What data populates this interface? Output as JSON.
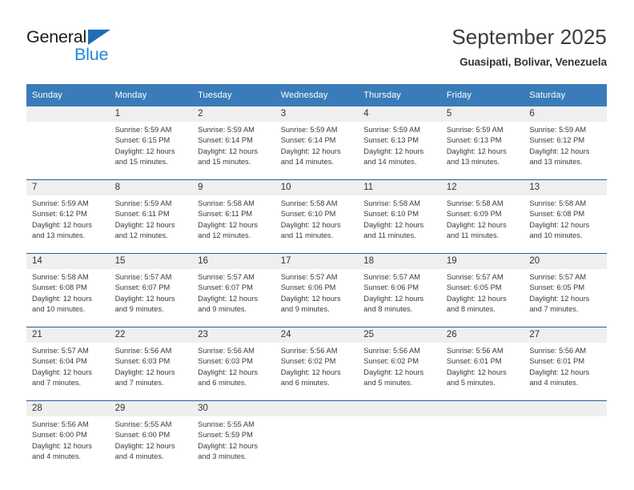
{
  "brand": {
    "name_part1": "General",
    "name_part2": "Blue",
    "accent_color": "#2288d6",
    "triangle_color": "#1f6db5"
  },
  "header": {
    "title": "September 2025",
    "subtitle": "Guasipati, Bolivar, Venezuela"
  },
  "calendar": {
    "header_bg": "#3a7cb9",
    "header_text_color": "#ffffff",
    "daynum_bg": "#efefef",
    "week_separator_color": "#1d5fa0",
    "weekday_headers": [
      "Sunday",
      "Monday",
      "Tuesday",
      "Wednesday",
      "Thursday",
      "Friday",
      "Saturday"
    ],
    "weeks": [
      [
        {
          "day": "",
          "sunrise": "",
          "sunset": "",
          "daylight_line1": "",
          "daylight_line2": ""
        },
        {
          "day": "1",
          "sunrise": "Sunrise: 5:59 AM",
          "sunset": "Sunset: 6:15 PM",
          "daylight_line1": "Daylight: 12 hours",
          "daylight_line2": "and 15 minutes."
        },
        {
          "day": "2",
          "sunrise": "Sunrise: 5:59 AM",
          "sunset": "Sunset: 6:14 PM",
          "daylight_line1": "Daylight: 12 hours",
          "daylight_line2": "and 15 minutes."
        },
        {
          "day": "3",
          "sunrise": "Sunrise: 5:59 AM",
          "sunset": "Sunset: 6:14 PM",
          "daylight_line1": "Daylight: 12 hours",
          "daylight_line2": "and 14 minutes."
        },
        {
          "day": "4",
          "sunrise": "Sunrise: 5:59 AM",
          "sunset": "Sunset: 6:13 PM",
          "daylight_line1": "Daylight: 12 hours",
          "daylight_line2": "and 14 minutes."
        },
        {
          "day": "5",
          "sunrise": "Sunrise: 5:59 AM",
          "sunset": "Sunset: 6:13 PM",
          "daylight_line1": "Daylight: 12 hours",
          "daylight_line2": "and 13 minutes."
        },
        {
          "day": "6",
          "sunrise": "Sunrise: 5:59 AM",
          "sunset": "Sunset: 6:12 PM",
          "daylight_line1": "Daylight: 12 hours",
          "daylight_line2": "and 13 minutes."
        }
      ],
      [
        {
          "day": "7",
          "sunrise": "Sunrise: 5:59 AM",
          "sunset": "Sunset: 6:12 PM",
          "daylight_line1": "Daylight: 12 hours",
          "daylight_line2": "and 13 minutes."
        },
        {
          "day": "8",
          "sunrise": "Sunrise: 5:59 AM",
          "sunset": "Sunset: 6:11 PM",
          "daylight_line1": "Daylight: 12 hours",
          "daylight_line2": "and 12 minutes."
        },
        {
          "day": "9",
          "sunrise": "Sunrise: 5:58 AM",
          "sunset": "Sunset: 6:11 PM",
          "daylight_line1": "Daylight: 12 hours",
          "daylight_line2": "and 12 minutes."
        },
        {
          "day": "10",
          "sunrise": "Sunrise: 5:58 AM",
          "sunset": "Sunset: 6:10 PM",
          "daylight_line1": "Daylight: 12 hours",
          "daylight_line2": "and 11 minutes."
        },
        {
          "day": "11",
          "sunrise": "Sunrise: 5:58 AM",
          "sunset": "Sunset: 6:10 PM",
          "daylight_line1": "Daylight: 12 hours",
          "daylight_line2": "and 11 minutes."
        },
        {
          "day": "12",
          "sunrise": "Sunrise: 5:58 AM",
          "sunset": "Sunset: 6:09 PM",
          "daylight_line1": "Daylight: 12 hours",
          "daylight_line2": "and 11 minutes."
        },
        {
          "day": "13",
          "sunrise": "Sunrise: 5:58 AM",
          "sunset": "Sunset: 6:08 PM",
          "daylight_line1": "Daylight: 12 hours",
          "daylight_line2": "and 10 minutes."
        }
      ],
      [
        {
          "day": "14",
          "sunrise": "Sunrise: 5:58 AM",
          "sunset": "Sunset: 6:08 PM",
          "daylight_line1": "Daylight: 12 hours",
          "daylight_line2": "and 10 minutes."
        },
        {
          "day": "15",
          "sunrise": "Sunrise: 5:57 AM",
          "sunset": "Sunset: 6:07 PM",
          "daylight_line1": "Daylight: 12 hours",
          "daylight_line2": "and 9 minutes."
        },
        {
          "day": "16",
          "sunrise": "Sunrise: 5:57 AM",
          "sunset": "Sunset: 6:07 PM",
          "daylight_line1": "Daylight: 12 hours",
          "daylight_line2": "and 9 minutes."
        },
        {
          "day": "17",
          "sunrise": "Sunrise: 5:57 AM",
          "sunset": "Sunset: 6:06 PM",
          "daylight_line1": "Daylight: 12 hours",
          "daylight_line2": "and 9 minutes."
        },
        {
          "day": "18",
          "sunrise": "Sunrise: 5:57 AM",
          "sunset": "Sunset: 6:06 PM",
          "daylight_line1": "Daylight: 12 hours",
          "daylight_line2": "and 8 minutes."
        },
        {
          "day": "19",
          "sunrise": "Sunrise: 5:57 AM",
          "sunset": "Sunset: 6:05 PM",
          "daylight_line1": "Daylight: 12 hours",
          "daylight_line2": "and 8 minutes."
        },
        {
          "day": "20",
          "sunrise": "Sunrise: 5:57 AM",
          "sunset": "Sunset: 6:05 PM",
          "daylight_line1": "Daylight: 12 hours",
          "daylight_line2": "and 7 minutes."
        }
      ],
      [
        {
          "day": "21",
          "sunrise": "Sunrise: 5:57 AM",
          "sunset": "Sunset: 6:04 PM",
          "daylight_line1": "Daylight: 12 hours",
          "daylight_line2": "and 7 minutes."
        },
        {
          "day": "22",
          "sunrise": "Sunrise: 5:56 AM",
          "sunset": "Sunset: 6:03 PM",
          "daylight_line1": "Daylight: 12 hours",
          "daylight_line2": "and 7 minutes."
        },
        {
          "day": "23",
          "sunrise": "Sunrise: 5:56 AM",
          "sunset": "Sunset: 6:03 PM",
          "daylight_line1": "Daylight: 12 hours",
          "daylight_line2": "and 6 minutes."
        },
        {
          "day": "24",
          "sunrise": "Sunrise: 5:56 AM",
          "sunset": "Sunset: 6:02 PM",
          "daylight_line1": "Daylight: 12 hours",
          "daylight_line2": "and 6 minutes."
        },
        {
          "day": "25",
          "sunrise": "Sunrise: 5:56 AM",
          "sunset": "Sunset: 6:02 PM",
          "daylight_line1": "Daylight: 12 hours",
          "daylight_line2": "and 5 minutes."
        },
        {
          "day": "26",
          "sunrise": "Sunrise: 5:56 AM",
          "sunset": "Sunset: 6:01 PM",
          "daylight_line1": "Daylight: 12 hours",
          "daylight_line2": "and 5 minutes."
        },
        {
          "day": "27",
          "sunrise": "Sunrise: 5:56 AM",
          "sunset": "Sunset: 6:01 PM",
          "daylight_line1": "Daylight: 12 hours",
          "daylight_line2": "and 4 minutes."
        }
      ],
      [
        {
          "day": "28",
          "sunrise": "Sunrise: 5:56 AM",
          "sunset": "Sunset: 6:00 PM",
          "daylight_line1": "Daylight: 12 hours",
          "daylight_line2": "and 4 minutes."
        },
        {
          "day": "29",
          "sunrise": "Sunrise: 5:55 AM",
          "sunset": "Sunset: 6:00 PM",
          "daylight_line1": "Daylight: 12 hours",
          "daylight_line2": "and 4 minutes."
        },
        {
          "day": "30",
          "sunrise": "Sunrise: 5:55 AM",
          "sunset": "Sunset: 5:59 PM",
          "daylight_line1": "Daylight: 12 hours",
          "daylight_line2": "and 3 minutes."
        },
        {
          "day": "",
          "sunrise": "",
          "sunset": "",
          "daylight_line1": "",
          "daylight_line2": ""
        },
        {
          "day": "",
          "sunrise": "",
          "sunset": "",
          "daylight_line1": "",
          "daylight_line2": ""
        },
        {
          "day": "",
          "sunrise": "",
          "sunset": "",
          "daylight_line1": "",
          "daylight_line2": ""
        },
        {
          "day": "",
          "sunrise": "",
          "sunset": "",
          "daylight_line1": "",
          "daylight_line2": ""
        }
      ]
    ]
  }
}
